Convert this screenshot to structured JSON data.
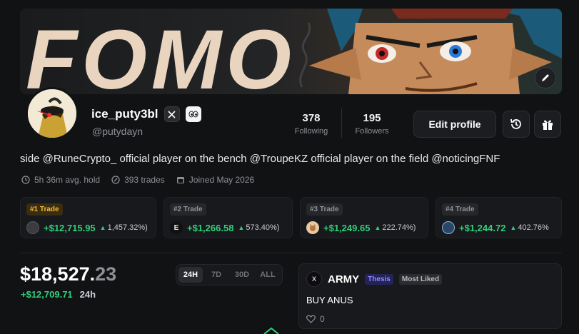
{
  "banner": {
    "art_text": "FOMO"
  },
  "profile": {
    "username": "ice_puty3bl",
    "handle": "@putydayn",
    "bio": "side @RuneCrypto_ official player on the bench @TroupeKZ official player on the field @noticingFNF",
    "meta": {
      "avg_hold": "5h 36m avg. hold",
      "trades": "393 trades",
      "joined": "Joined May 2026"
    }
  },
  "stats": {
    "following": {
      "value": "378",
      "label": "Following"
    },
    "followers": {
      "value": "195",
      "label": "Followers"
    }
  },
  "actions": {
    "edit_profile": "Edit profile"
  },
  "top_trades": [
    {
      "tag": "#1 Trade",
      "profit": "+$12,715.95",
      "pct": "1,457.32%)",
      "token": "dark-coin"
    },
    {
      "tag": "#2 Trade",
      "profit": "+$1,266.58",
      "pct": "573.40%)",
      "token": "E"
    },
    {
      "tag": "#3 Trade",
      "profit": "+$1,249.65",
      "pct": "222.74%)",
      "token": "cat-coin"
    },
    {
      "tag": "#4 Trade",
      "profit": "+$1,244.72",
      "pct": "402.76%",
      "token": "blue-coin"
    }
  ],
  "portfolio": {
    "value_main": "$18,527.",
    "value_cents": "23",
    "change": "+$12,709.71",
    "period": "24h"
  },
  "timeframes": [
    "24H",
    "7D",
    "30D",
    "ALL"
  ],
  "active_timeframe": "24H",
  "post": {
    "logo_text": "X",
    "author": "ARMY",
    "badge_thesis": "Thesis",
    "badge_liked": "Most Liked",
    "body": "BUY ANUS",
    "likes": "0"
  },
  "colors": {
    "positive": "#2fd17a",
    "gold": "#f0b93c",
    "thesis": "#8b8bff"
  }
}
